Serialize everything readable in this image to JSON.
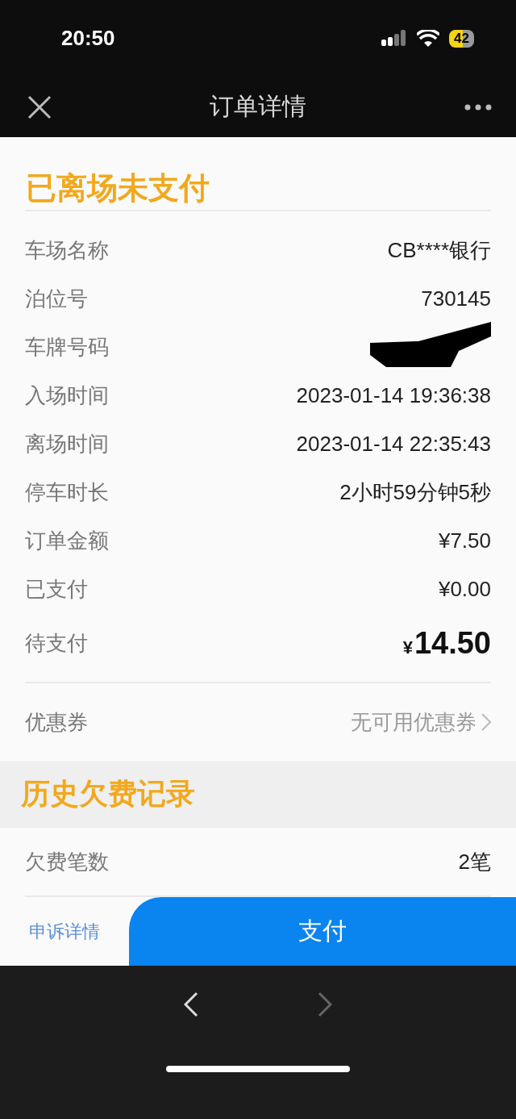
{
  "status_bar": {
    "time": "20:50",
    "battery": "42"
  },
  "nav": {
    "title": "订单详情"
  },
  "status": "已离场未支付",
  "details": [
    {
      "label": "车场名称",
      "value": "CB****银行",
      "kind": "text",
      "redacted": false
    },
    {
      "label": "泊位号",
      "value": "730145",
      "kind": "text",
      "redacted": false
    },
    {
      "label": "车牌号码",
      "kind": "text",
      "redacted": true
    },
    {
      "label": "入场时间",
      "value": "2023-01-14 19:36:38",
      "kind": "text",
      "redacted": false
    },
    {
      "label": "离场时间",
      "value": "2023-01-14 22:35:43",
      "kind": "text",
      "redacted": false
    },
    {
      "label": "停车时长",
      "value": "2小时59分钟5秒",
      "kind": "text",
      "redacted": false
    },
    {
      "label": "订单金额",
      "value": "¥7.50",
      "kind": "text",
      "redacted": false
    },
    {
      "label": "已支付",
      "value": "¥0.00",
      "kind": "text",
      "redacted": false
    },
    {
      "label": "待支付",
      "currency": "¥",
      "value": "14.50",
      "kind": "amount",
      "redacted": false
    }
  ],
  "coupon": {
    "label": "优惠券",
    "value": "无可用优惠券"
  },
  "history": {
    "title": "历史欠费记录",
    "rows": [
      {
        "label": "欠费笔数",
        "value": "2笔"
      }
    ]
  },
  "footer": {
    "link": "申诉详情",
    "button": "支付"
  },
  "browser_bar": {
    "back_disabled": false,
    "forward_disabled": true
  }
}
